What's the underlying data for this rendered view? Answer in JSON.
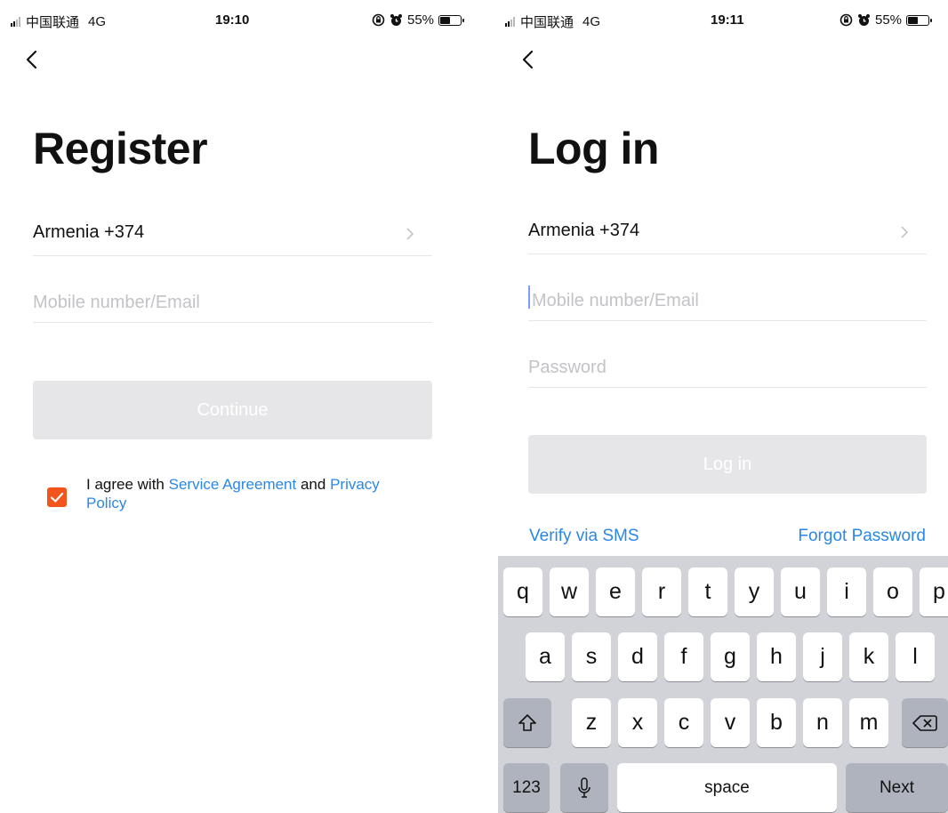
{
  "status_left": {
    "carrier": "中国联通",
    "network": "4G",
    "time": "19:10",
    "battery": "55%",
    "battery_level": 0.55
  },
  "status_right": {
    "carrier": "中国联通",
    "network": "4G",
    "time": "19:11",
    "battery": "55%",
    "battery_level": 0.55
  },
  "register": {
    "title": "Register",
    "country": "Armenia +374",
    "mobile_placeholder": "Mobile number/Email",
    "continue_label": "Continue",
    "agree_checked": true,
    "agree_prefix": "I agree with ",
    "service_agreement": "Service Agreement",
    "agree_and": " and ",
    "privacy_policy": "Privacy Policy"
  },
  "login": {
    "title": "Log in",
    "country": "Armenia +374",
    "mobile_placeholder": "Mobile number/Email",
    "password_placeholder": "Password",
    "login_label": "Log in",
    "verify_sms": "Verify via SMS",
    "forgot_password": "Forgot Password"
  },
  "keyboard": {
    "row1": [
      "q",
      "w",
      "e",
      "r",
      "t",
      "y",
      "u",
      "i",
      "o",
      "p"
    ],
    "row2": [
      "a",
      "s",
      "d",
      "f",
      "g",
      "h",
      "j",
      "k",
      "l"
    ],
    "row3": [
      "z",
      "x",
      "c",
      "v",
      "b",
      "n",
      "m"
    ],
    "numbers_label": "123",
    "space_label": "space",
    "next_label": "Next",
    "shift_icon": "shift-icon",
    "backspace_icon": "backspace-icon",
    "mic_icon": "microphone-icon"
  },
  "colors": {
    "accent_orange": "#f2541b",
    "link_blue": "#2b87e6",
    "disabled_button": "#e6e6e9",
    "placeholder": "#c3c3c7",
    "keyboard_bg": "#d1d3d9"
  }
}
